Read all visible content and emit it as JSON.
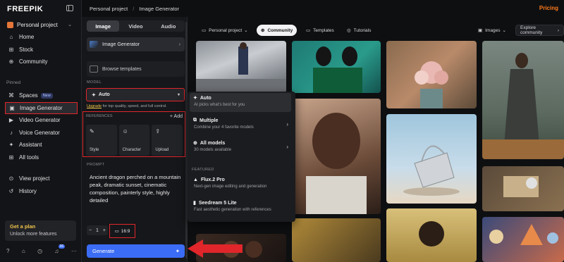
{
  "brand": {
    "logo": "FREEPIK"
  },
  "sidebar": {
    "project": "Personal project",
    "items_top": [
      {
        "label": "Home",
        "icon": "home-icon",
        "glyph": "⌂"
      },
      {
        "label": "Stock",
        "icon": "grid-icon",
        "glyph": "⊞"
      },
      {
        "label": "Community",
        "icon": "globe-icon",
        "glyph": "⊕"
      }
    ],
    "pinned_label": "Pinned",
    "items_pinned": [
      {
        "label": "Spaces",
        "icon": "spaces-icon",
        "glyph": "⌘",
        "badge": "New"
      },
      {
        "label": "Image Generator",
        "icon": "image-icon",
        "glyph": "▣",
        "active": true
      },
      {
        "label": "Video Generator",
        "icon": "video-icon",
        "glyph": "▶"
      },
      {
        "label": "Voice Generator",
        "icon": "mic-icon",
        "glyph": "♪"
      },
      {
        "label": "Assistant",
        "icon": "sparkle-icon",
        "glyph": "✦"
      },
      {
        "label": "All tools",
        "icon": "apps-icon",
        "glyph": "⊞"
      }
    ],
    "items_bottom": [
      {
        "label": "View project",
        "icon": "view-icon",
        "glyph": "⊙"
      },
      {
        "label": "History",
        "icon": "history-icon",
        "glyph": "↺"
      }
    ],
    "plan": {
      "title": "Get a plan",
      "subtitle": "Unlock more features"
    },
    "notification_count": "36"
  },
  "topbar": {
    "crumb1": "Personal project",
    "crumb2": "Image Generator",
    "pricing": "Pricing"
  },
  "panel": {
    "tabs": [
      "Image",
      "Video",
      "Audio"
    ],
    "model_card": "Image Generator",
    "browse": "Browse templates",
    "model_label": "MODEL",
    "model_value": "Auto",
    "upgrade_link": "Upgrade",
    "upgrade_text": " for top quality, speed, and full control.",
    "references_label": "REFERENCES",
    "add_label": "+ Add",
    "refs": [
      {
        "label": "Style",
        "glyph": "✎"
      },
      {
        "label": "Character",
        "glyph": "☺"
      },
      {
        "label": "Upload",
        "glyph": "⇪"
      }
    ],
    "prompt_label": "PROMPT",
    "prompt": "Ancient dragon perched on a mountain peak, dramatic sunset, cinematic composition, painterly style, highly detailed",
    "count": "1",
    "ratio": "16:9",
    "generate": "Generate"
  },
  "gallery_bar": {
    "project": "Personal project",
    "community": "Community",
    "templates": "Templates",
    "tutorials": "Tutorials",
    "images": "Images",
    "explore": "Explore community"
  },
  "dropdown": {
    "items": [
      {
        "title": "Auto",
        "subtitle": "AI picks what's best for you",
        "selected": true
      },
      {
        "title": "Multiple",
        "subtitle": "Combine your 4 favorite models",
        "chevron": true
      },
      {
        "title": "All models",
        "subtitle": "30 models available",
        "chevron": true
      }
    ],
    "featured_label": "FEATURED",
    "featured": [
      {
        "title": "Flux.2 Pro",
        "subtitle": "Next-gen image editing and generation"
      },
      {
        "title": "Seedream 5 Lite",
        "subtitle": "Fast aesthetic generation with references"
      }
    ]
  },
  "colors": {
    "accent": "#3b6cf5",
    "highlight": "#e0262a",
    "pricing": "#ff7a1a",
    "plan": "#f0c44a"
  }
}
